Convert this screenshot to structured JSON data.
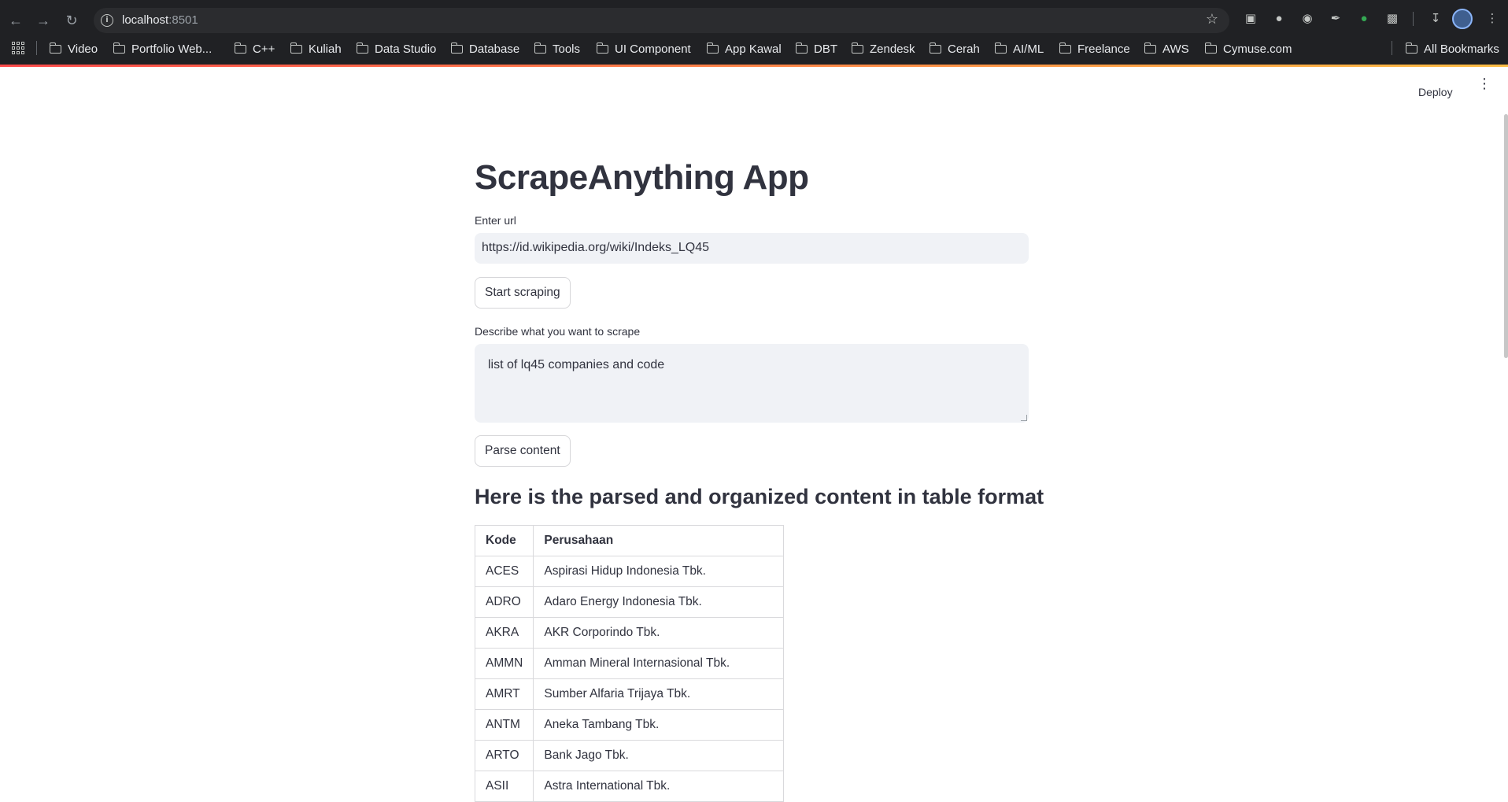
{
  "browser": {
    "url_host": "localhost",
    "url_port": ":8501",
    "bookmarks": [
      "Video",
      "Portfolio Web...",
      "C++",
      "Kuliah",
      "Data Studio",
      "Database",
      "Tools",
      "UI Component",
      "App Kawal",
      "DBT",
      "Zendesk",
      "Cerah",
      "AI/ML",
      "Freelance",
      "AWS",
      "Cymuse.com"
    ],
    "all_bookmarks": "All Bookmarks"
  },
  "header": {
    "deploy_label": "Deploy"
  },
  "main": {
    "title": "ScrapeAnything App",
    "url_label": "Enter url",
    "url_value": "https://id.wikipedia.org/wiki/Indeks_LQ45",
    "scrape_button": "Start scraping",
    "describe_label": "Describe what you want to scrape",
    "describe_value": "list of lq45 companies and code",
    "parse_button": "Parse content",
    "result_heading": "Here is the parsed and organized content in table format"
  },
  "table": {
    "headers": [
      "Kode",
      "Perusahaan"
    ],
    "rows": [
      [
        "ACES",
        "Aspirasi Hidup Indonesia Tbk."
      ],
      [
        "ADRO",
        "Adaro Energy Indonesia Tbk."
      ],
      [
        "AKRA",
        "AKR Corporindo Tbk."
      ],
      [
        "AMMN",
        "Amman Mineral Internasional Tbk."
      ],
      [
        "AMRT",
        "Sumber Alfaria Trijaya Tbk."
      ],
      [
        "ANTM",
        "Aneka Tambang Tbk."
      ],
      [
        "ARTO",
        "Bank Jago Tbk."
      ],
      [
        "ASII",
        "Astra International Tbk."
      ]
    ]
  }
}
